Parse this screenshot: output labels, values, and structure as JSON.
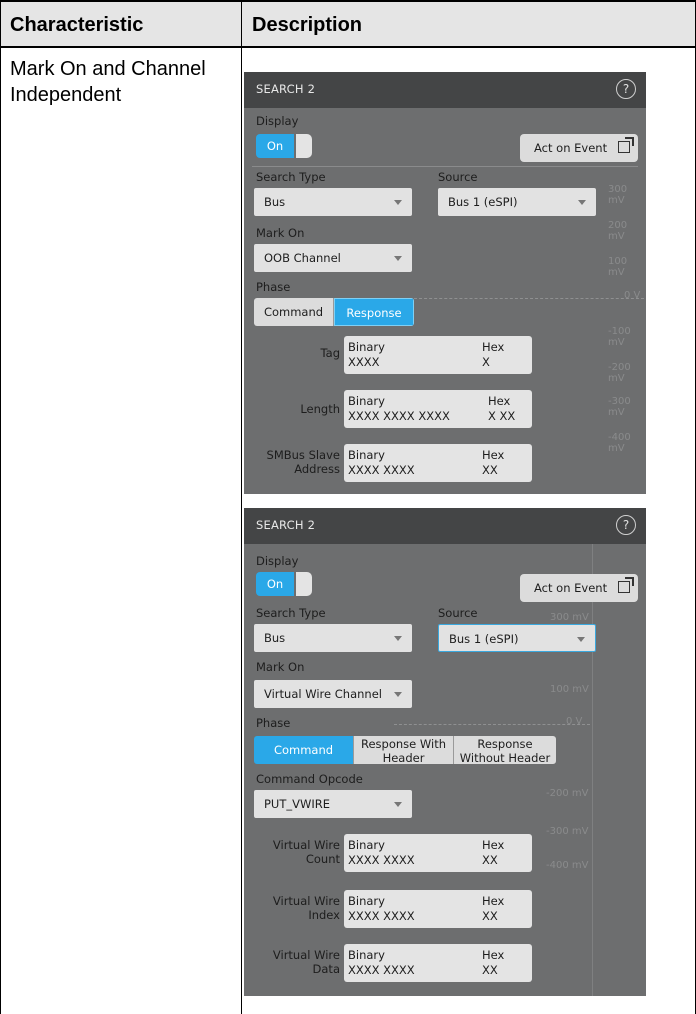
{
  "table": {
    "header": {
      "col1": "Characteristic",
      "col2": "Description"
    },
    "row": {
      "characteristic_line1": "Mark On and Channel",
      "characteristic_line2": "Independent"
    }
  },
  "panel1": {
    "title": "SEARCH 2",
    "help": "?",
    "display_label": "Display",
    "toggle_on": "On",
    "act_on_event": "Act on Event",
    "search_type_label": "Search Type",
    "search_type_value": "Bus",
    "source_label": "Source",
    "source_value": "Bus 1 (eSPI)",
    "mark_on_label": "Mark On",
    "mark_on_value": "OOB Channel",
    "phase_label": "Phase",
    "phase_options": [
      "Command",
      "Response"
    ],
    "fields": [
      {
        "label1": "Tag",
        "label2": "",
        "cap1": "Binary",
        "cap2": "Hex",
        "val1": "XXXX",
        "val2": "X"
      },
      {
        "label1": "Length",
        "label2": "",
        "cap1": "Binary",
        "cap2": "Hex",
        "val1": "XXXX XXXX XXXX",
        "val2": "X XX"
      },
      {
        "label1": "SMBus Slave",
        "label2": "Address",
        "cap1": "Binary",
        "cap2": "Hex",
        "val1": "XXXX XXXX",
        "val2": "XX"
      }
    ],
    "ghost_labels": [
      "300 mV",
      "200 mV",
      "100 mV",
      "0 V",
      "-100 mV",
      "-200 mV",
      "-300 mV",
      "-400 mV"
    ]
  },
  "panel2": {
    "title": "SEARCH 2",
    "help": "?",
    "display_label": "Display",
    "toggle_on": "On",
    "act_on_event": "Act on Event",
    "search_type_label": "Search Type",
    "search_type_value": "Bus",
    "source_label": "Source",
    "source_value": "Bus 1 (eSPI)",
    "mark_on_label": "Mark On",
    "mark_on_value": "Virtual Wire Channel",
    "phase_label": "Phase",
    "phase_options": [
      {
        "line1": "Command",
        "line2": ""
      },
      {
        "line1": "Response With",
        "line2": "Header"
      },
      {
        "line1": "Response",
        "line2": "Without Header"
      }
    ],
    "opcode_label": "Command Opcode",
    "opcode_value": "PUT_VWIRE",
    "fields": [
      {
        "label1": "Virtual Wire",
        "label2": "Count",
        "cap1": "Binary",
        "cap2": "Hex",
        "val1": "XXXX XXXX",
        "val2": "XX"
      },
      {
        "label1": "Virtual Wire",
        "label2": "Index",
        "cap1": "Binary",
        "cap2": "Hex",
        "val1": "XXXX XXXX",
        "val2": "XX"
      },
      {
        "label1": "Virtual Wire",
        "label2": "Data",
        "cap1": "Binary",
        "cap2": "Hex",
        "val1": "XXXX XXXX",
        "val2": "XX"
      }
    ],
    "ghost_labels": [
      "300 mV",
      "100 mV",
      "0 V",
      "-200 mV",
      "-300 mV",
      "-400 mV"
    ]
  }
}
